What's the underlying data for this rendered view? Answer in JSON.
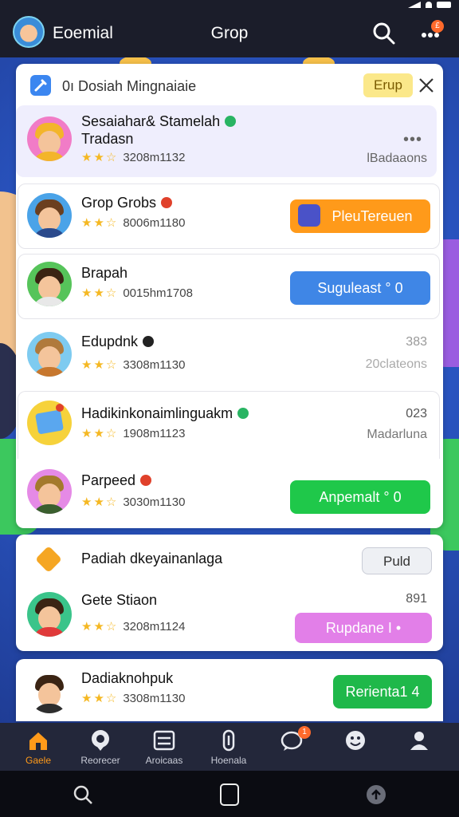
{
  "app": {
    "title": "Eoemial",
    "group_title": "Grop",
    "more_badge": "£"
  },
  "main_card": {
    "header": {
      "title": "0ı Dosiah Mingnaiaie",
      "chip": "Erup"
    },
    "rows": [
      {
        "name": "Sesaiahar& Stamelah",
        "sub": "Tradasn",
        "meta": "3208m1132",
        "right": "lBadaaons",
        "has_dots": true
      },
      {
        "name": "Grop Grobs",
        "meta": "8006m1180",
        "button": "PleuTereuen"
      },
      {
        "name": "Brapah",
        "meta": "0015hm1708",
        "button": "Suguleast ° 0"
      },
      {
        "name": "Edupdnk",
        "meta": "3308m1130",
        "right_top": "383",
        "right": "20clateons"
      },
      {
        "name": "Hadikinkonaimlinguakm",
        "meta": "1908m1123",
        "right_top": "023",
        "right": "Madarluna"
      },
      {
        "name": "Parpeed",
        "meta": "3030m1130",
        "button": "Anpemalt ° 0"
      }
    ]
  },
  "card2": {
    "title": "Padiah dkeyainanlaga",
    "chip": "Puld",
    "row": {
      "name": "Gete Stiaon",
      "meta": "3208m1124",
      "right_top": "891",
      "button": "Rupdane I •"
    }
  },
  "card3": {
    "row": {
      "name": "Dadiaknohpuk",
      "meta": "3308m1130",
      "button": "Rerienta1 4"
    }
  },
  "nav": [
    {
      "label": "Gaele",
      "icon": "home-icon",
      "active": true
    },
    {
      "label": "Reorecer",
      "icon": "chat-bubble-icon"
    },
    {
      "label": "Aroicaas",
      "icon": "inbox-icon"
    },
    {
      "label": "Hoenala",
      "icon": "bottle-icon"
    },
    {
      "label": "",
      "icon": "message-icon",
      "badge": "1"
    },
    {
      "label": "",
      "icon": "smile-icon"
    },
    {
      "label": "",
      "icon": "profile-icon"
    }
  ],
  "colors": {
    "accent_orange": "#ff9a1a",
    "accent_blue": "#3f86e6",
    "accent_green": "#1fc84a",
    "accent_pink": "#e27fe8"
  }
}
